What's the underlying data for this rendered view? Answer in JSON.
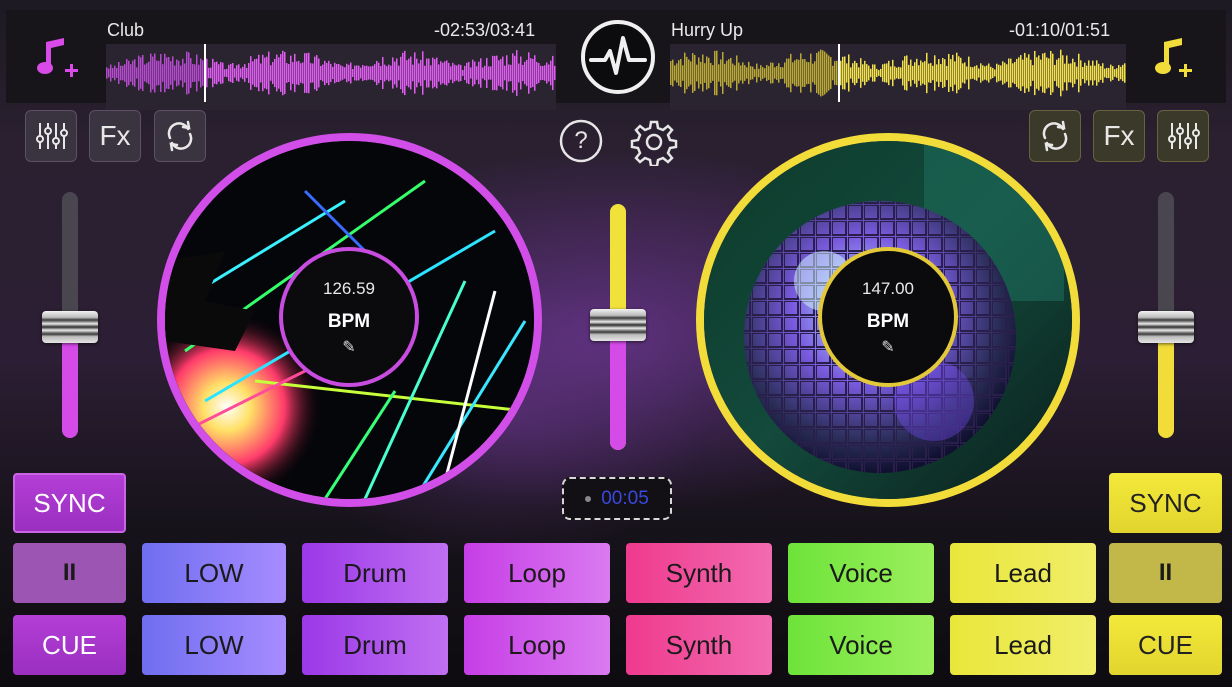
{
  "deck_left": {
    "track_title": "Club",
    "track_time": "-02:53/03:41",
    "bpm": "126.59",
    "bpm_label": "BPM",
    "accent": "#d54be8"
  },
  "deck_right": {
    "track_title": "Hurry Up",
    "track_time": "-01:10/01:51",
    "bpm": "147.00",
    "bpm_label": "BPM",
    "accent": "#f2e23a"
  },
  "toolbar": {
    "fx_label": "Fx"
  },
  "center": {
    "help_label": "?",
    "timer": "00:05"
  },
  "pads": {
    "sync": "SYNC",
    "pause": "II",
    "cue": "CUE",
    "low": "LOW",
    "drum": "Drum",
    "loop": "Loop",
    "synth": "Synth",
    "voice": "Voice",
    "lead": "Lead"
  },
  "levels": {
    "left_volume": 0.45,
    "crossfader": 0.51,
    "right_volume": 0.45
  },
  "icons": [
    "music-add-icon",
    "waveform-logo-icon",
    "equalizer-icon",
    "fx-icon",
    "loop-icon",
    "help-icon",
    "gear-icon",
    "pencil-icon"
  ]
}
